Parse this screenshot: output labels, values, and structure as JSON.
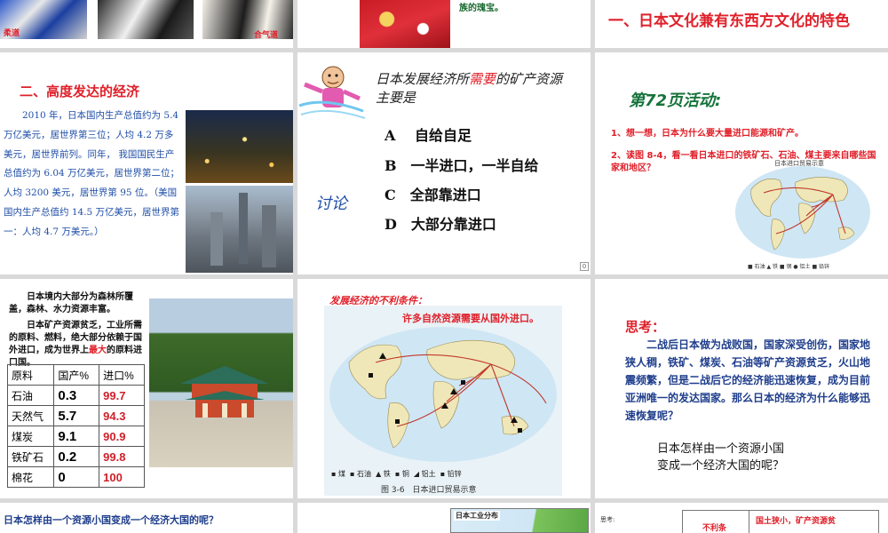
{
  "slide1": {
    "caption_left": "柔道",
    "caption_right": "合气道"
  },
  "slide2": {
    "text": "族的瑰宝。"
  },
  "slide3": {
    "title": "一、日本文化兼有东西方文化的特色"
  },
  "slide4": {
    "title": "二、高度发达的经济",
    "body": "2010 年，日本国内生产总值约为 5.4 万亿美元，居世界第三位；人均 4.2 万多美元，居世界前列。同年， 我国国民生产总值约为 6.04 万亿美元，居世界第二位；人均 3200 美元，居世界第 95 位。（美国国内生产总值约 14.5 万亿美元，居世界第一：人均 4.7 万美元。）"
  },
  "slide5": {
    "question_pre": "日本发展经济所",
    "question_key": "需要",
    "question_post": "的矿产资源主要是",
    "side_label": "讨论",
    "options": [
      "A　 自给自足",
      "B　一半进口，一半自给",
      "C　全部靠进口",
      "D　大部分靠进口"
    ],
    "page_no": "0"
  },
  "slide6": {
    "title": "第72页活动:",
    "q1": "1、想一想，日本为什么要大量进口能源和矿产。",
    "q2": "2、读图 8-4，看一看日本进口的铁矿石、石油、煤主要来自哪些国家和地区？",
    "map_title": "日本进口贸易示意",
    "legend": "■ 石油 ▲ 铁 ■ 钢 ● 铝土 ■ 铅锌"
  },
  "slide7": {
    "p1": "日本境内大部分为森林所覆盖，森林、水力资源丰富。",
    "p2_pre": "日本矿产资源贫乏，工业所需的原料、燃料，绝大部分依赖于国外进口，成为世界上",
    "p2_key": "最大",
    "p2_post": "的原料进口国。",
    "table_header": [
      "原料",
      "国产%",
      "进口%"
    ],
    "table_rows": [
      [
        "石油",
        "0.3",
        "99.7"
      ],
      [
        "天然气",
        "5.7",
        "94.3"
      ],
      [
        "煤炭",
        "9.1",
        "90.9"
      ],
      [
        "铁矿石",
        "0.2",
        "99.8"
      ],
      [
        "棉花",
        "0",
        "100"
      ]
    ]
  },
  "slide8": {
    "heading": "发展经济的不利条件：",
    "banner": "许多自然资源需要从国外进口。",
    "legend": "▪ 煤  ▪ 石油  ▲ 铁  ▪ 铜  ◢ 铝土  ▪ 铅锌",
    "caption": "图 3-6　日本进口贸易示意"
  },
  "slide9": {
    "title": "思考：",
    "body": "二战后日本做为战败国，国家深受创伤，国家地狭人稠，铁矿、煤炭、石油等矿产资源贫乏，火山地震频繁，但是二战后它的经济能迅速恢复，成为目前亚洲唯一的发达国家。那么日本的经济为什么能够迅速恢复呢？",
    "q_line1": "日本怎样由一个资源小国",
    "q_line2": "变成一个经济大国的呢？"
  },
  "slide10": {
    "text": "日本怎样由一个资源小国变成一个经济大国的呢？"
  },
  "slide11": {
    "map_title": "日本工业分布"
  },
  "slide12": {
    "label": "思考:",
    "cell_left": "不利条",
    "cell_right": "国土狭小，矿产资源贫"
  }
}
